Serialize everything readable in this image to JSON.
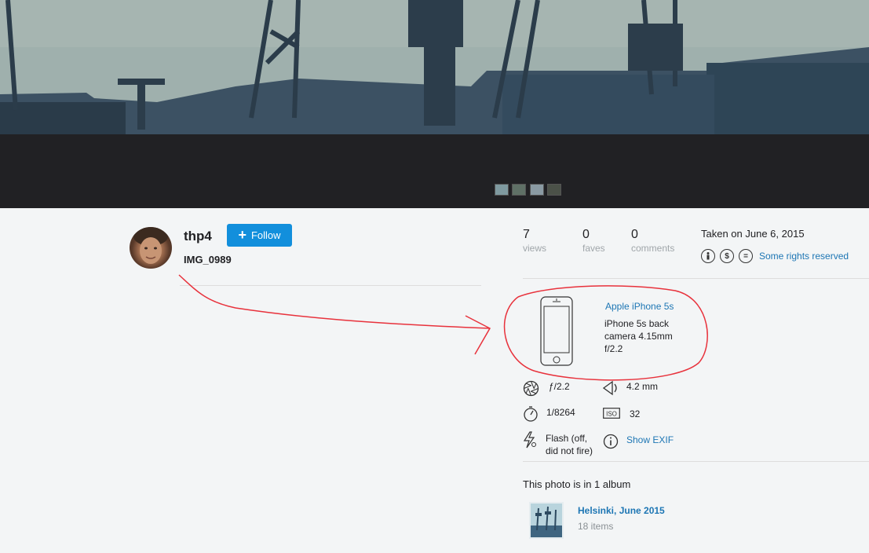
{
  "owner": {
    "username": "thp4",
    "follow_label": "Follow",
    "photo_title": "IMG_0989"
  },
  "stats": {
    "views": {
      "count": "7",
      "label": "views"
    },
    "faves": {
      "count": "0",
      "label": "faves"
    },
    "comments": {
      "count": "0",
      "label": "comments"
    }
  },
  "taken": "Taken on June 6, 2015",
  "license": {
    "label": "Some rights reserved",
    "icons": [
      "cc-by-icon",
      "cc-nc-icon",
      "cc-nd-icon"
    ]
  },
  "camera": {
    "model": "Apple iPhone 5s",
    "details": "iPhone 5s back camera 4.15mm f/2.2"
  },
  "exif": {
    "aperture": "ƒ/2.2",
    "focal_length": "4.2 mm",
    "shutter": "1/8264",
    "iso": "32",
    "flash": "Flash (off, did not fire)",
    "show_exif": "Show EXIF"
  },
  "album": {
    "heading": "This photo is in 1 album",
    "name": "Helsinki, June 2015",
    "count": "18 items"
  },
  "colors": {
    "accent": "#128fdc",
    "link": "#1d76b4",
    "filmstrip_bg": "#212124",
    "page_bg": "#f3f5f6",
    "annotation": "#e8323c"
  }
}
